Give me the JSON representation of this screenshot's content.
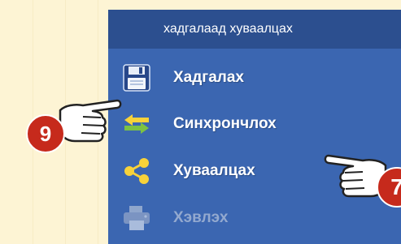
{
  "panel": {
    "title": "хадгалаад хуваалцах",
    "items": [
      {
        "label": "Хадгалах",
        "icon": "floppy-disk-icon",
        "enabled": true
      },
      {
        "label": "Синхрончлох",
        "icon": "sync-arrows-icon",
        "enabled": true
      },
      {
        "label": "Хуваалцах",
        "icon": "share-icon",
        "enabled": true
      },
      {
        "label": "Хэвлэх",
        "icon": "printer-icon",
        "enabled": false
      }
    ]
  },
  "callouts": [
    {
      "number": "9",
      "target": "Синхрончлох"
    },
    {
      "number": "7",
      "target": "Хуваалцах"
    }
  ],
  "colors": {
    "background": "#fdf4d4",
    "panel": "#3b66b1",
    "header": "#2c4f8f",
    "badge": "#c62a1c"
  }
}
